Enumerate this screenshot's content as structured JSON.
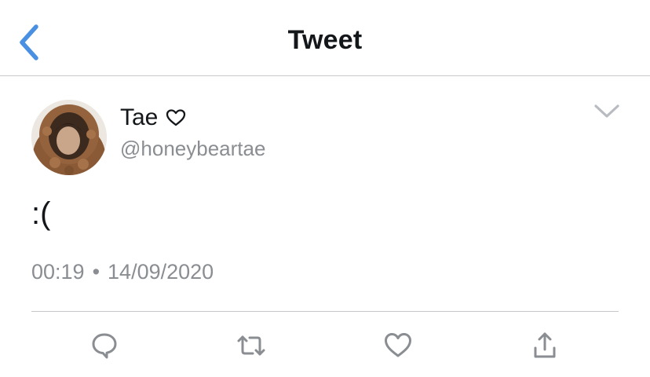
{
  "nav": {
    "title": "Tweet",
    "back_icon": "chevron-left-icon",
    "accent_color": "#4a90e2"
  },
  "tweet": {
    "display_name": "Tae",
    "name_emoji_icon": "heart-outline-icon",
    "handle": "@honeybeartae",
    "text": ":(",
    "time": "00:19",
    "separator": "•",
    "date": "14/09/2020",
    "menu_icon": "chevron-down-icon"
  },
  "actions": [
    {
      "name": "reply",
      "icon": "reply-bubble-icon"
    },
    {
      "name": "retweet",
      "icon": "retweet-icon"
    },
    {
      "name": "like",
      "icon": "heart-icon"
    },
    {
      "name": "share",
      "icon": "share-icon"
    }
  ],
  "colors": {
    "text_primary": "#14171a",
    "text_secondary": "#8a8d91",
    "icon_gray": "#8a8d91",
    "divider": "#c8c8cc"
  }
}
